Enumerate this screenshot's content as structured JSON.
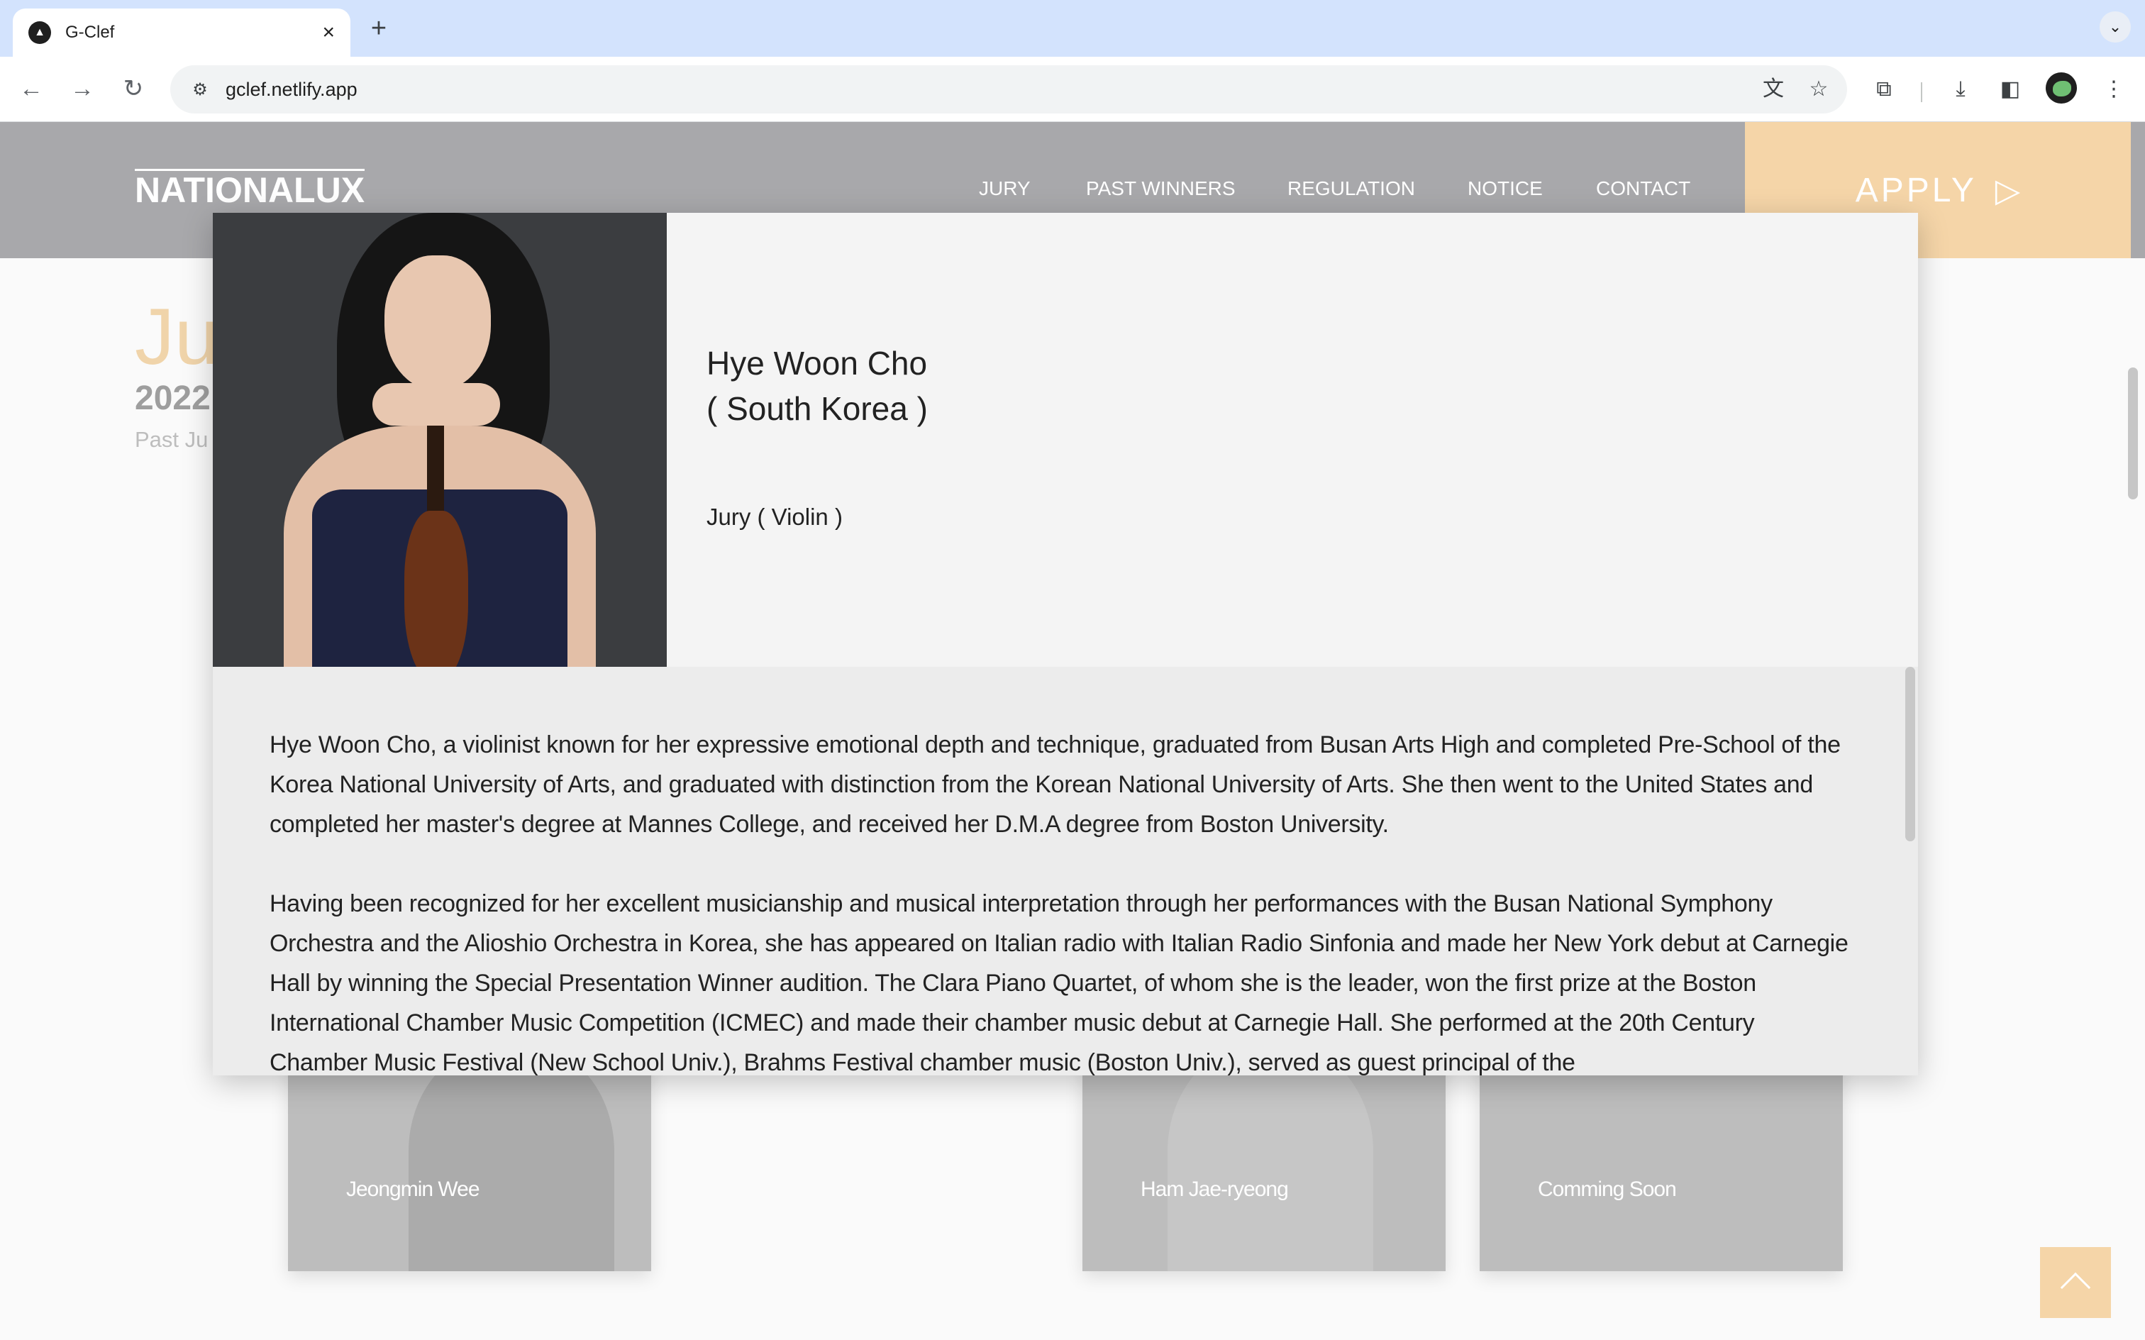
{
  "browser": {
    "tab_title": "G-Clef",
    "url": "gclef.netlify.app"
  },
  "site": {
    "logo": "NATIONALUX",
    "nav": [
      "JURY",
      "PAST WINNERS",
      "REGULATION",
      "NOTICE",
      "CONTACT"
    ],
    "apply_label": "APPLY",
    "background": {
      "heading": "Ju",
      "year": "2022",
      "subtitle": "Past Ju"
    },
    "cards": [
      {
        "label": "Jeongmin Wee"
      },
      {
        "label": "Ham Jae-ryeong"
      },
      {
        "label": "Comming Soon"
      }
    ]
  },
  "modal": {
    "name": "Hye Woon Cho",
    "country": "( South Korea )",
    "role": "Jury ( Violin )",
    "bio": [
      "Hye Woon Cho, a violinist known for her expressive emotional depth and technique, graduated from Busan Arts High and completed Pre-School of the Korea National University of Arts, and graduated with distinction from the Korean National University of Arts. She then went to the United States and completed her master's degree at Mannes College, and received her D.M.A degree from Boston University.",
      "Having been recognized for her excellent musicianship and musical interpretation through her performances with the Busan National Symphony Orchestra and the Alioshio Orchestra in Korea, she has appeared on Italian radio with Italian Radio Sinfonia and made her New York debut at Carnegie Hall by winning the Special Presentation Winner audition. The Clara Piano Quartet, of whom she is the leader, won the first prize at the Boston International Chamber Music Competition (ICMEC) and made their chamber music debut at Carnegie Hall. She performed at the 20th Century Chamber Music Festival (New School Univ.), Brahms Festival chamber music (Boston Univ.), served as guest principal of the"
    ]
  },
  "icons": {
    "back": "arrow-left-icon",
    "forward": "arrow-right-icon",
    "reload": "reload-icon",
    "translate": "translate-icon",
    "bookmark": "star-icon",
    "extensions": "puzzle-icon",
    "download": "download-icon",
    "sidepanel": "side-panel-icon",
    "apply": "paper-plane-icon",
    "scroll_top": "chevron-up-icon"
  }
}
